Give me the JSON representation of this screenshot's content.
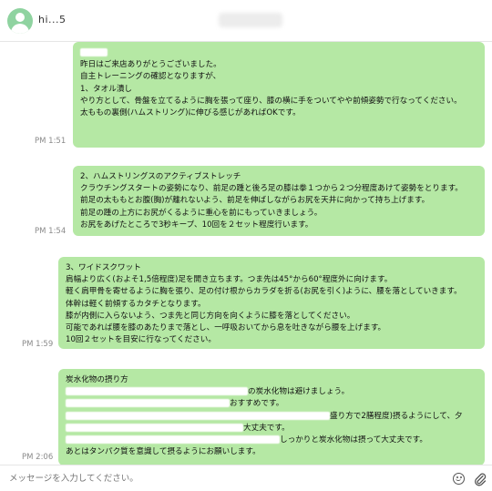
{
  "header": {
    "contact_name": "hi...5",
    "avatar_icon": "user-avatar-icon"
  },
  "messages": [
    {
      "time": "PM 1:51",
      "lines": [
        "",
        "",
        "昨日はご来店ありがとうございました。",
        "自主トレーニングの確認となりますが、",
        "1、タオル潰し",
        "やり方として、骨盤を立てるように胸を張って座り、膝の横に手をついてやや前傾姿勢で行なってください。",
        "太ももの裏側(ハムストリング)に伸びる感じがあればOKです。"
      ]
    },
    {
      "time": "PM 1:54",
      "lines": [
        "2、ハムストリングスのアクティブストレッチ",
        "クラウチングスタートの姿勢になり、前足の踵と後ろ足の膝は拳１つから２つ分程度あけて姿勢をとります。",
        "前足の太ももとお腹(胸)が離れないよう、前足を伸ばしながらお尻を天井に向かって持ち上げます。",
        "前足の踵の上方にお尻がくるように重心を前にもっていきましょう。",
        "お尻をあげたところで3秒キープ、10回を２セット程度行います。"
      ]
    },
    {
      "time": "PM 1:59",
      "lines": [
        "3、ワイドスクワット",
        "肩幅より広く(およそ1,5倍程度)足を開き立ちます。つま先は45°から60°程度外に向けます。",
        "軽く肩甲骨を寄せるように胸を張り、足の付け根からカラダを折る(お尻を引く)ように、腰を落としていきます。",
        "体幹は軽く前傾するカタチとなります。",
        "膝が内側に入らないよう、つま先と同じ方向を向くように膝を落としてください。",
        "可能であれば腰を膝のあたりまで落とし、一呼吸おいてから息を吐きながら腰を上げます。",
        "10回２セットを目安に行なってください。"
      ]
    },
    {
      "time": "PM 2:06",
      "lines": [
        "炭水化物の摂り方",
        "の炭水化物は避けましょう。",
        "おすすめです。",
        "盛り方で2膳程度)摂るようにして、夕",
        "大丈夫です。",
        "しっかりと炭水化物は摂って大丈夫です。",
        "あとはタンパク質を意識して摂るようにお願いします。"
      ]
    }
  ],
  "footer": {
    "placeholder": "メッセージを入力してください。",
    "emoji_icon": "smiley-icon",
    "attach_icon": "paperclip-icon"
  },
  "colors": {
    "bubble": "#b5e8a4",
    "background": "#ffffff",
    "avatar": "#8fd3a0"
  }
}
